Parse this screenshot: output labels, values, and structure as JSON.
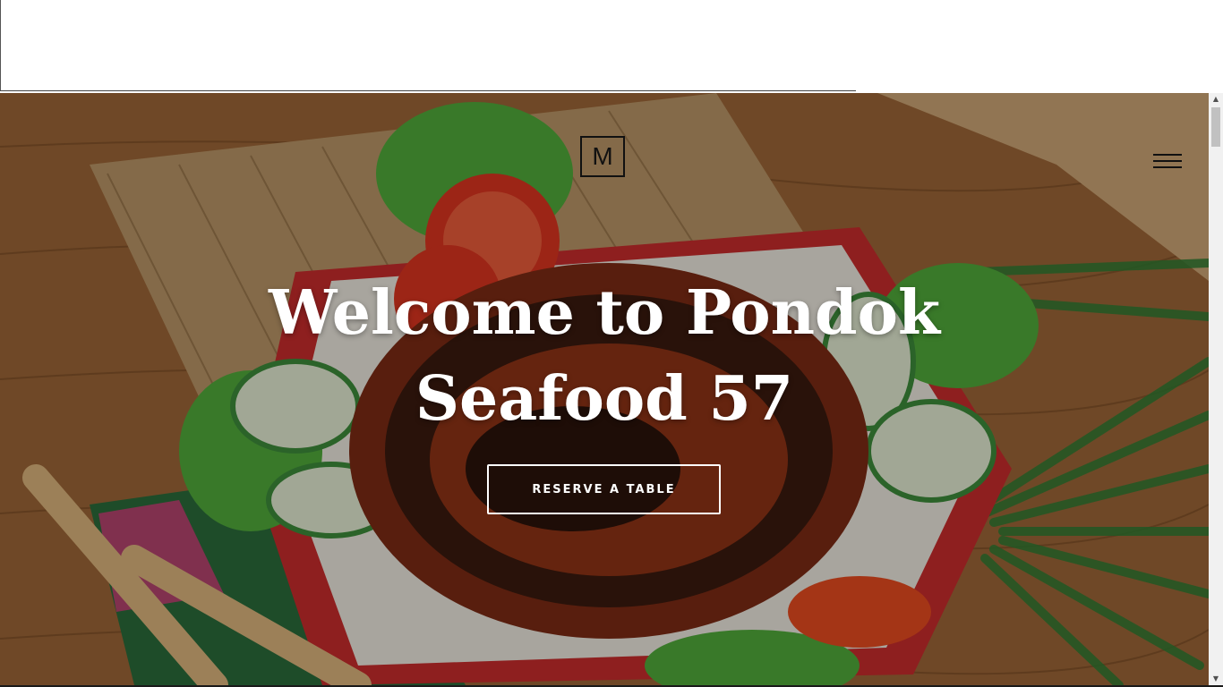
{
  "header": {
    "logo_letter": "M",
    "menu_icon": "hamburger-menu-icon"
  },
  "hero": {
    "title": "Welcome to Pondok Seafood 57",
    "cta_label": "RESERVE A TABLE",
    "background_description_icon": "seafood-dish-image"
  },
  "colors": {
    "title_text": "#ffffff",
    "cta_border": "#ffffff",
    "logo_border": "#111111"
  },
  "scrollbar": {
    "up_arrow": "▲",
    "down_arrow": "▼"
  }
}
